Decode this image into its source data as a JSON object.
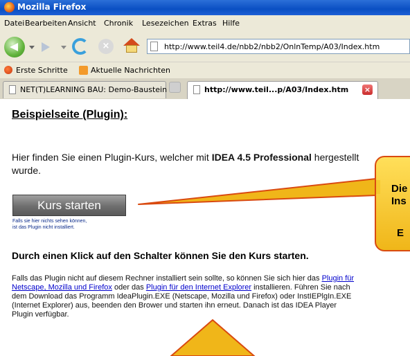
{
  "window": {
    "title": "Mozilla Firefox"
  },
  "menu": [
    "Datei",
    "Bearbeiten",
    "Ansicht",
    "Chronik",
    "Lesezeichen",
    "Extras",
    "Hilfe"
  ],
  "navigation": {
    "url": "http://www.teil4.de/nbb2/nbb2/OnlnTemp/A03/Index.htm"
  },
  "bookmarks": [
    "Erste Schritte",
    "Aktuelle Nachrichten"
  ],
  "tabs": [
    {
      "label": "NET(T)LEARNING BAU: Demo-Baustein",
      "active": false
    },
    {
      "label": "http://www.teil...p/A03/Index.htm",
      "active": true
    }
  ],
  "page": {
    "heading": "Beispielseite (Plugin):",
    "intro_prefix": "Hier finden Sie einen Plugin-Kurs, welcher mit ",
    "intro_bold": "IDEA 4.5 Professional",
    "intro_suffix": " hergestellt wurde.",
    "start_button": "Kurs starten",
    "hint_line1": "Falls sie hier nichts sehen können,",
    "hint_line2": "ist das Plugin nicht installiert.",
    "instruction": "Durch einen Klick auf den Schalter können Sie den Kurs starten.",
    "body_part1": "Falls das Plugin nicht auf diesem Rechner installiert sein sollte, so können Sie sich hier das ",
    "link_netscape": "Plugin für Netscape, Mozilla und Firefox",
    "body_part2": " oder das ",
    "link_ie": "Plugin für den Internet Explorer",
    "body_part3": " installieren. Führen Sie nach dem Download das Programm IdeaPlugin.EXE (Netscape, Mozilla und Firefox) oder InstIEPlgIn.EXE (Internet Explorer) aus, beenden den Brower und starten ihn erneut. Danach ist das IDEA Player Plugin verfügbar."
  },
  "callout": {
    "line1": "Die",
    "line2": "Ins",
    "line3": "E"
  },
  "colors": {
    "titlebar": "#0a4fc3",
    "callout_fill": "#f7c62a",
    "callout_border": "#d94a10",
    "link": "#0000cc"
  }
}
